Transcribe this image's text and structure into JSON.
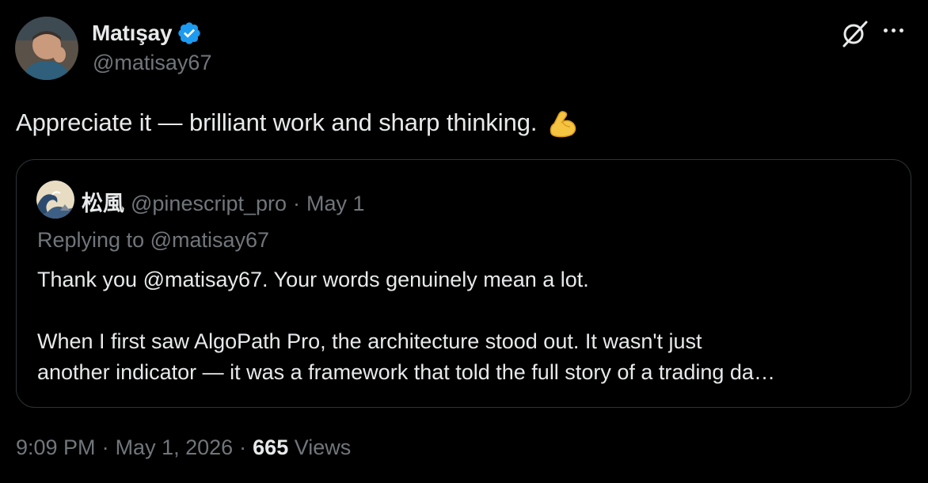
{
  "author": {
    "display_name": "Matışay",
    "handle": "@matisay67",
    "verified": true,
    "avatar_icon": "user-avatar-photo"
  },
  "header_actions": {
    "grok_icon": "grok-icon",
    "more_icon": "more-options-icon"
  },
  "tweet": {
    "text": "Appreciate it — brilliant work and sharp thinking.",
    "emoji": "flexed-biceps"
  },
  "quoted": {
    "display_name": "松風",
    "handle": "@pinescript_pro",
    "separator": "·",
    "date": "May 1",
    "replying_label": "Replying to",
    "replying_handle": "@matisay67",
    "paragraph1": "Thank you @matisay67. Your words genuinely mean a lot.",
    "paragraph2_line1": "When I first saw AlgoPath Pro, the architecture stood out. It wasn't just",
    "paragraph2_line2": "another indicator — it was a framework that told the full story of a trading da…"
  },
  "meta": {
    "time": "9:09 PM",
    "sep1": "·",
    "date": "May 1, 2026",
    "sep2": "·",
    "views_count": "665",
    "views_label": "Views"
  },
  "colors": {
    "background": "#000000",
    "primary_text": "#e7e9ea",
    "secondary_text": "#71767b",
    "border": "#2f3336",
    "verified_blue": "#1d9bf0"
  }
}
